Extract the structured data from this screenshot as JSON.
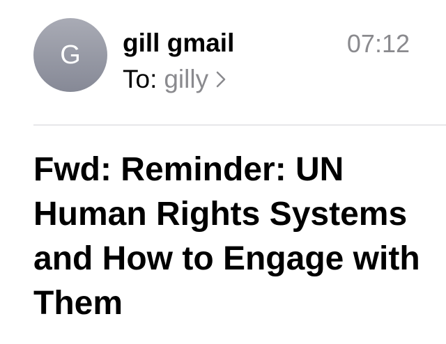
{
  "sender": {
    "avatar_letter": "G",
    "name": "gill gmail",
    "time": "07:12"
  },
  "recipient": {
    "to_label": "To:",
    "name": "gilly"
  },
  "email": {
    "subject": "Fwd: Reminder: UN Human Rights Systems and How to Engage with Them"
  },
  "icons": {
    "recipient_chevron": "chevron-right-icon"
  },
  "colors": {
    "avatar": "#979aa5",
    "secondary_text": "#8a8a8e",
    "divider": "#d1d1d6"
  }
}
